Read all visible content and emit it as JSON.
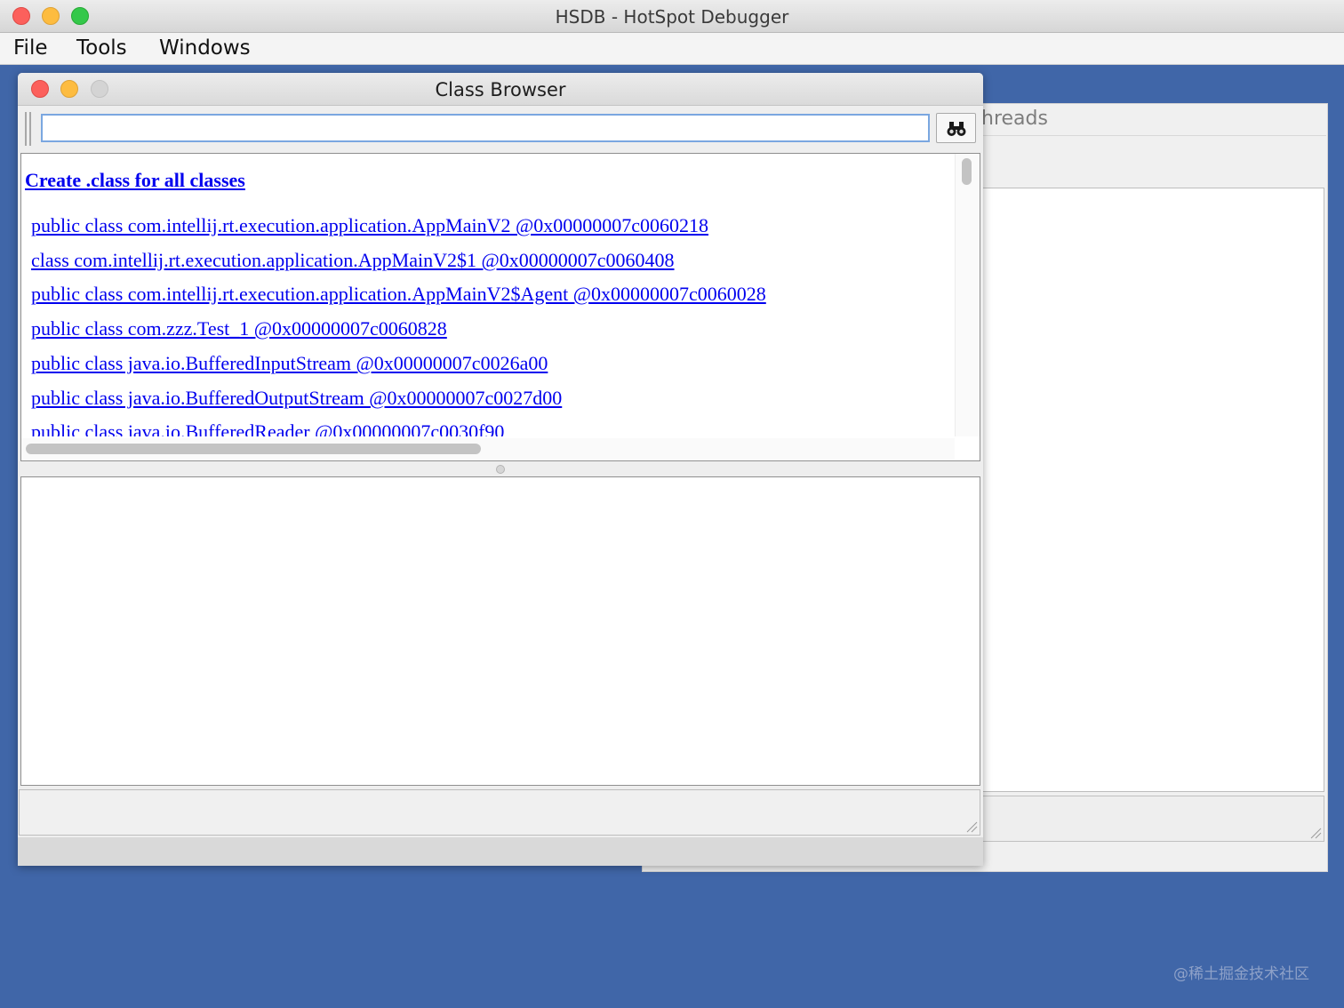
{
  "window": {
    "title": "HSDB - HotSpot Debugger"
  },
  "menubar": {
    "items": [
      "File",
      "Tools",
      "Windows"
    ]
  },
  "background_frame": {
    "tab_label": "hreads"
  },
  "class_browser": {
    "title": "Class Browser",
    "search": {
      "value": "",
      "placeholder": ""
    },
    "search_button_icon": "binoculars-icon",
    "create_link": "Create .class for all classes",
    "classes": [
      "public class com.intellij.rt.execution.application.AppMainV2 @0x00000007c0060218",
      "class com.intellij.rt.execution.application.AppMainV2$1 @0x00000007c0060408",
      "public class com.intellij.rt.execution.application.AppMainV2$Agent @0x00000007c0060028",
      "public class com.zzz.Test_1 @0x00000007c0060828",
      "public class java.io.BufferedInputStream @0x00000007c0026a00",
      "public class java.io.BufferedOutputStream @0x00000007c0027d00",
      "public class java.io.BufferedReader @0x00000007c0030f90"
    ]
  },
  "watermark": "@稀土掘金技术社区",
  "colors": {
    "desktop": "#4066a8",
    "link": "#0000ee",
    "close": "#fc605c",
    "minimize": "#fdbc40",
    "maximize": "#34c84a"
  }
}
